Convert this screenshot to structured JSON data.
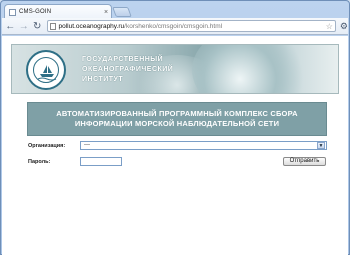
{
  "browser": {
    "tab_title": "CMS-GOIN",
    "tab_close": "×",
    "url_host": "pollut.oceanography.ru",
    "url_path": "/korshenko/cmsgoin/cmsgoin.html"
  },
  "header": {
    "institute_line1": "ГОСУДАРСТВЕННЫЙ",
    "institute_line2": "ОКЕАНОГРАФИЧЕСКИЙ",
    "institute_line3": "ИНСТИТУТ"
  },
  "title": {
    "line1": "АВТОМАТИЗИРОВАННЫЙ ПРОГРАММНЫЙ КОМПЛЕКС СБОРА",
    "line2": "ИНФОРМАЦИИ МОРСКОЙ НАБЛЮДАТЕЛЬНОЙ СЕТИ"
  },
  "form": {
    "org_label": "Организация:",
    "org_value": "---",
    "password_label": "Пароль:",
    "submit_label": "Отправить"
  }
}
